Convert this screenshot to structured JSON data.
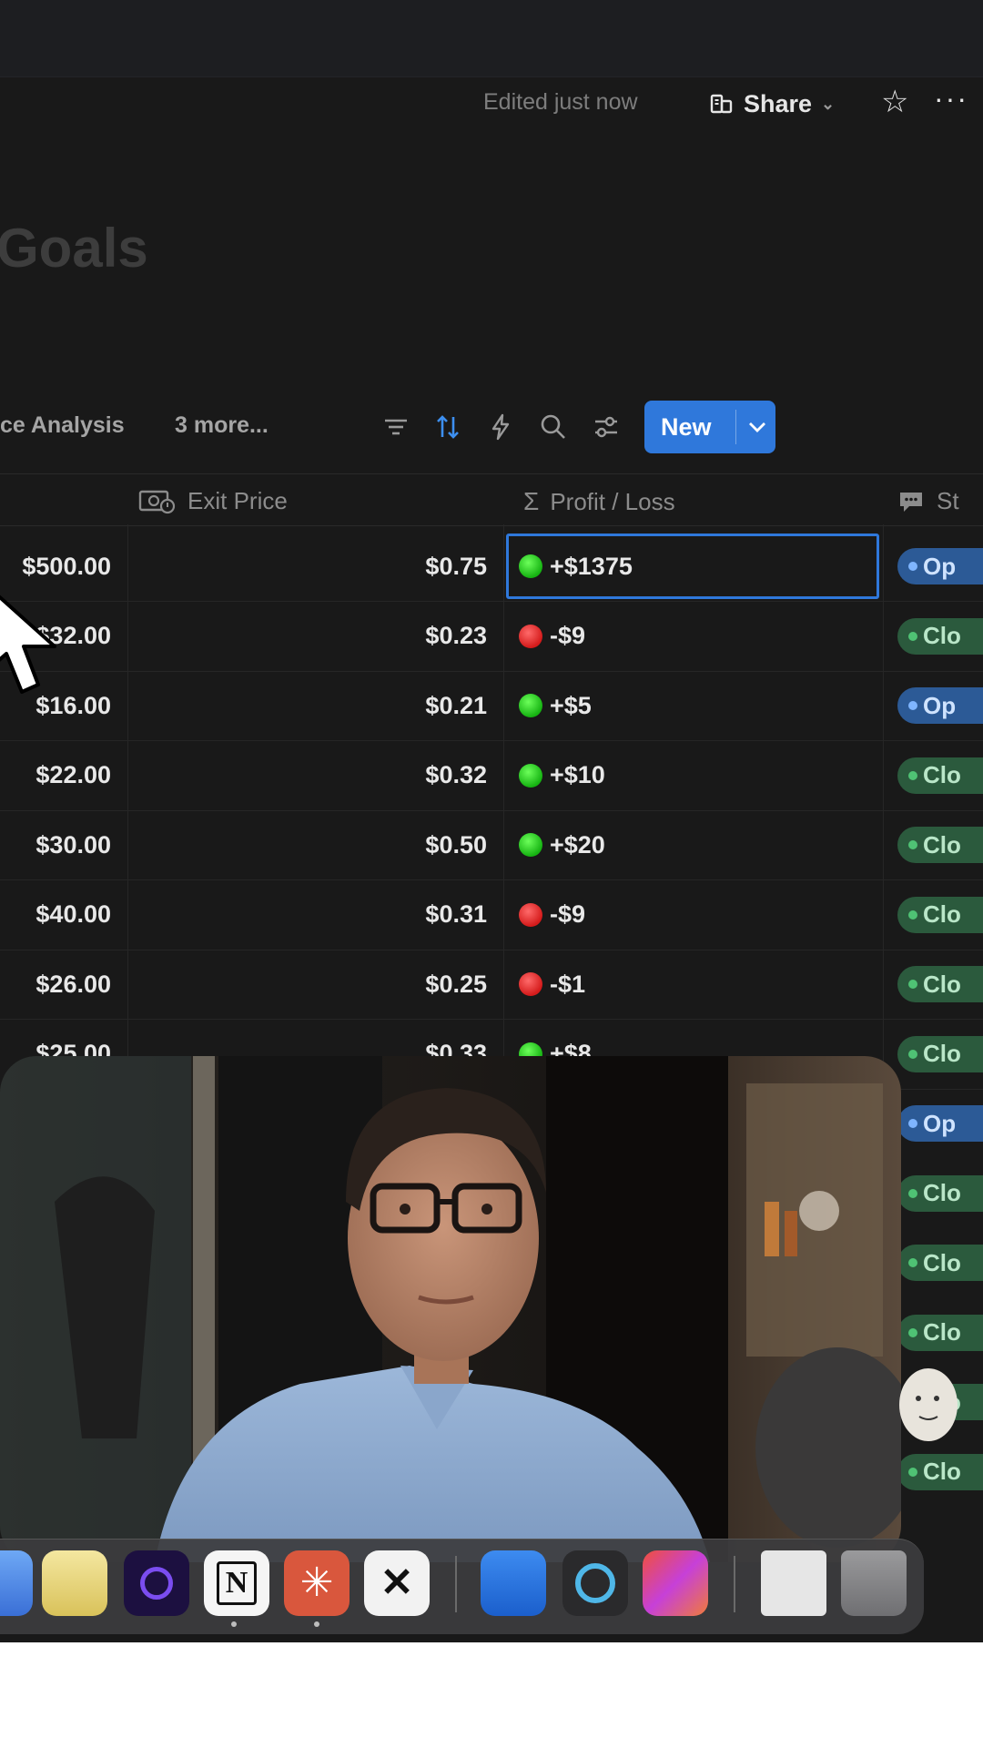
{
  "header": {
    "edited_text": "Edited just now",
    "share_label": "Share",
    "share_chevron": "⌄",
    "star_icon": "star-icon",
    "more_label": "···"
  },
  "page": {
    "title": "Goals"
  },
  "toolbar": {
    "view_label": "ce Analysis",
    "more_views_label": "3 more...",
    "new_label": "New",
    "icons": [
      "filter-icon",
      "sort-icon",
      "automation-icon",
      "search-icon",
      "settings-icon"
    ]
  },
  "table": {
    "headers": {
      "exit_price": "Exit Price",
      "profit_loss": "Profit / Loss",
      "status": "St"
    },
    "rows": [
      {
        "entry": "$500.00",
        "exit": "$0.75",
        "pl": "+$1375",
        "pl_color": "green",
        "status": "Op",
        "status_type": "open"
      },
      {
        "entry": "$32.00",
        "exit": "$0.23",
        "pl": "-$9",
        "pl_color": "red",
        "status": "Clo",
        "status_type": "closed"
      },
      {
        "entry": "$16.00",
        "exit": "$0.21",
        "pl": "+$5",
        "pl_color": "green",
        "status": "Op",
        "status_type": "open"
      },
      {
        "entry": "$22.00",
        "exit": "$0.32",
        "pl": "+$10",
        "pl_color": "green",
        "status": "Clo",
        "status_type": "closed"
      },
      {
        "entry": "$30.00",
        "exit": "$0.50",
        "pl": "+$20",
        "pl_color": "green",
        "status": "Clo",
        "status_type": "closed"
      },
      {
        "entry": "$40.00",
        "exit": "$0.31",
        "pl": "-$9",
        "pl_color": "red",
        "status": "Clo",
        "status_type": "closed"
      },
      {
        "entry": "$26.00",
        "exit": "$0.25",
        "pl": "-$1",
        "pl_color": "red",
        "status": "Clo",
        "status_type": "closed"
      },
      {
        "entry": "$25.00",
        "exit": "$0.33",
        "pl": "+$8",
        "pl_color": "green",
        "status": "Clo",
        "status_type": "closed"
      }
    ],
    "extra_status": [
      {
        "status": "Op",
        "status_type": "open"
      },
      {
        "status": "Clo",
        "status_type": "closed"
      },
      {
        "status": "Clo",
        "status_type": "closed"
      },
      {
        "status": "Clo",
        "status_type": "closed"
      },
      {
        "status": "Clo",
        "status_type": "closed"
      },
      {
        "status": "Clo",
        "status_type": "closed"
      }
    ]
  },
  "dock": {
    "icons": [
      "finder-icon",
      "notes-icon",
      "arc-browser-icon",
      "notion-icon",
      "claude-icon",
      "capcut-icon",
      "word-icon",
      "quicktime-icon",
      "creative-cloud-icon",
      "folder-icon",
      "trash-icon"
    ],
    "notion_letter": "N"
  },
  "colors": {
    "accent": "#2f78db",
    "profit": "#16b312",
    "loss": "#d41b1b",
    "open_tag": "#2c5a96",
    "closed_tag": "#2b5a3d"
  }
}
